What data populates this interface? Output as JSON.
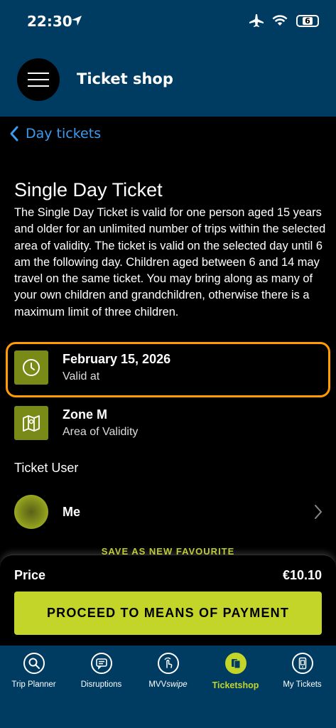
{
  "status_bar": {
    "time": "22:30",
    "battery": "6"
  },
  "header": {
    "title": "Ticket shop"
  },
  "nav": {
    "back_label": "Day tickets"
  },
  "ticket": {
    "title": "Single Day Ticket",
    "description": "The Single Day Ticket is valid for one person aged 15 years and older for an unlimited number of trips within the selected area of validity. The ticket is valid on the selected day until 6 am the following day. Children aged between 6 and 14 may travel on the same ticket. You may bring along as many of your own children and grandchildren, otherwise there is a maximum limit of three children.",
    "date": {
      "value": "February 15, 2026",
      "label": "Valid at"
    },
    "zone": {
      "value": "Zone M",
      "label": "Area of Validity"
    }
  },
  "ticket_user": {
    "heading": "Ticket User",
    "name": "Me"
  },
  "save_favourite": "SAVE AS NEW FAVOURITE",
  "price": {
    "label": "Price",
    "value": "€10.10"
  },
  "proceed_button": "PROCEED TO MEANS OF PAYMENT",
  "colors": {
    "header_bg": "#003c62",
    "accent": "#c4d52a",
    "highlight": "#ff9c00",
    "link": "#3b9bf0",
    "icon_bg": "#7a8a16"
  },
  "tabs": [
    {
      "label": "Trip Planner",
      "icon": "magnifier-icon"
    },
    {
      "label": "Disruptions",
      "icon": "message-icon"
    },
    {
      "label_main": "MVV",
      "label_italic": "swipe",
      "icon": "swipe-hand-icon"
    },
    {
      "label": "Ticketshop",
      "icon": "tickets-icon",
      "active": true
    },
    {
      "label": "My Tickets",
      "icon": "phone-ticket-icon"
    }
  ]
}
